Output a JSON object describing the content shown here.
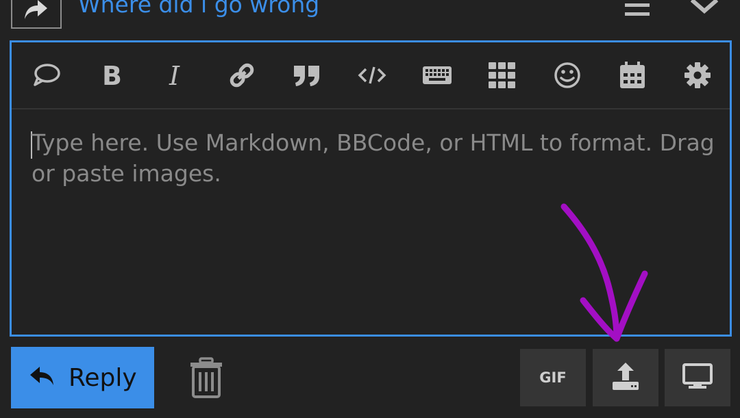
{
  "header": {
    "topic_title": "Where did i go wrong",
    "reply_icon": "reply-arrow-icon",
    "menu_icon": "hamburger-icon",
    "collapse_icon": "chevron-down-icon"
  },
  "toolbar": {
    "items": [
      {
        "name": "quote-bubble",
        "icon": "speech-bubble-icon"
      },
      {
        "name": "bold",
        "icon": "bold-icon"
      },
      {
        "name": "italic",
        "icon": "italic-icon"
      },
      {
        "name": "link",
        "icon": "link-icon"
      },
      {
        "name": "blockquote",
        "icon": "quote-icon"
      },
      {
        "name": "code",
        "icon": "code-icon"
      },
      {
        "name": "keyboard",
        "icon": "keyboard-icon"
      },
      {
        "name": "grid",
        "icon": "grid-icon"
      },
      {
        "name": "emoji",
        "icon": "smiley-icon"
      },
      {
        "name": "calendar",
        "icon": "calendar-icon"
      },
      {
        "name": "settings",
        "icon": "gear-icon"
      }
    ]
  },
  "editor": {
    "placeholder": "Type here. Use Markdown, BBCode, or HTML to format. Drag or paste images."
  },
  "footer": {
    "reply_label": "Reply",
    "gif_label": "GIF",
    "upload_icon": "upload-icon",
    "preview_icon": "monitor-icon",
    "trash_icon": "trash-icon"
  },
  "colors": {
    "accent": "#3b8ee8",
    "background": "#222222",
    "annotation": "#a30fc4"
  }
}
